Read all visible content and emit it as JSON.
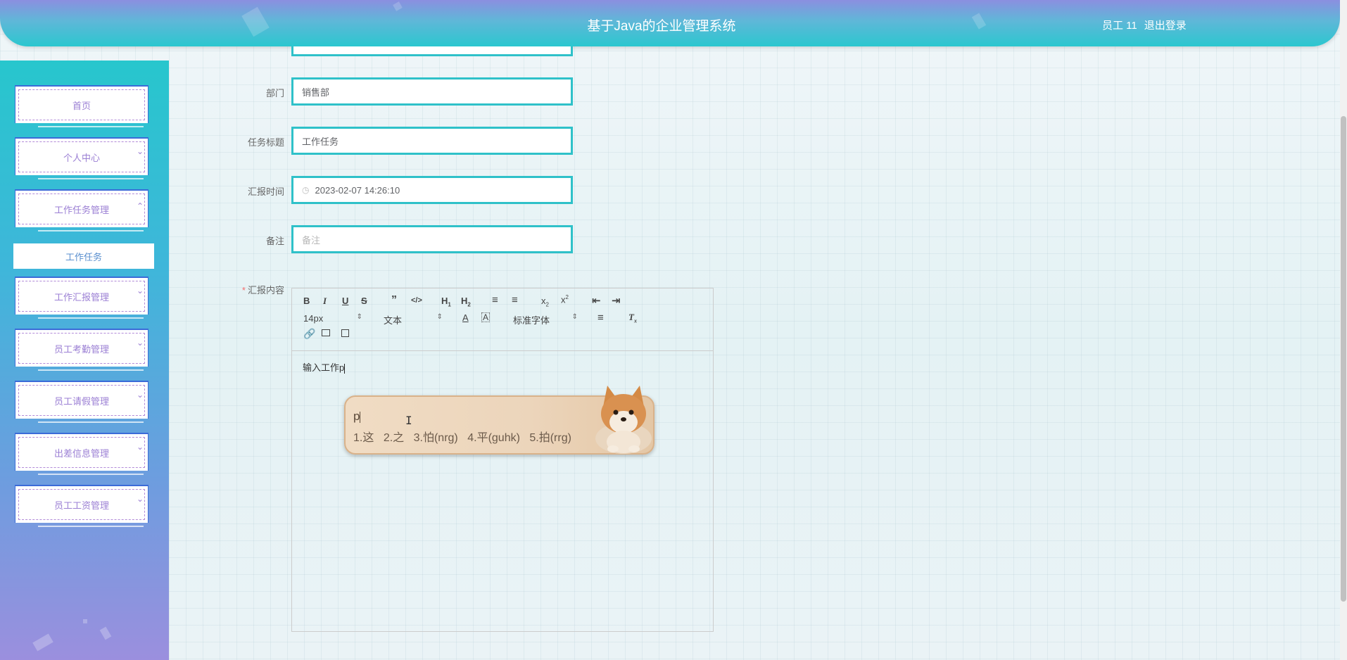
{
  "header": {
    "title": "基于Java的企业管理系统",
    "user": "员工 11",
    "logout": "退出登录"
  },
  "sidebar": {
    "items": [
      {
        "label": "首页",
        "icon": "none"
      },
      {
        "label": "个人中心",
        "icon": "chevron-down"
      },
      {
        "label": "工作任务管理",
        "icon": "chevron-up"
      },
      {
        "label": "工作汇报管理",
        "icon": "chevron-down"
      },
      {
        "label": "员工考勤管理",
        "icon": "chevron-down"
      },
      {
        "label": "员工请假管理",
        "icon": "chevron-down"
      },
      {
        "label": "出差信息管理",
        "icon": "chevron-down"
      },
      {
        "label": "员工工资管理",
        "icon": "chevron-down"
      }
    ],
    "submenu": {
      "label": "工作任务"
    }
  },
  "form": {
    "department": {
      "label": "部门",
      "value": "销售部"
    },
    "task_title": {
      "label": "任务标题",
      "value": "工作任务"
    },
    "report_time": {
      "label": "汇报时间",
      "value": "2023-02-07 14:26:10"
    },
    "remark": {
      "label": "备注",
      "placeholder": "备注"
    },
    "content": {
      "label": "汇报内容",
      "required_mark": "*"
    }
  },
  "editor": {
    "font_size": "14px",
    "header_select": "文本",
    "font_family": "标准字体",
    "text": "输入工作p"
  },
  "ime": {
    "composition": "p",
    "candidates": [
      "1.这",
      "2.之",
      "3.怕(nrg)",
      "4.平(guhk)",
      "5.拍(rrg)"
    ]
  }
}
